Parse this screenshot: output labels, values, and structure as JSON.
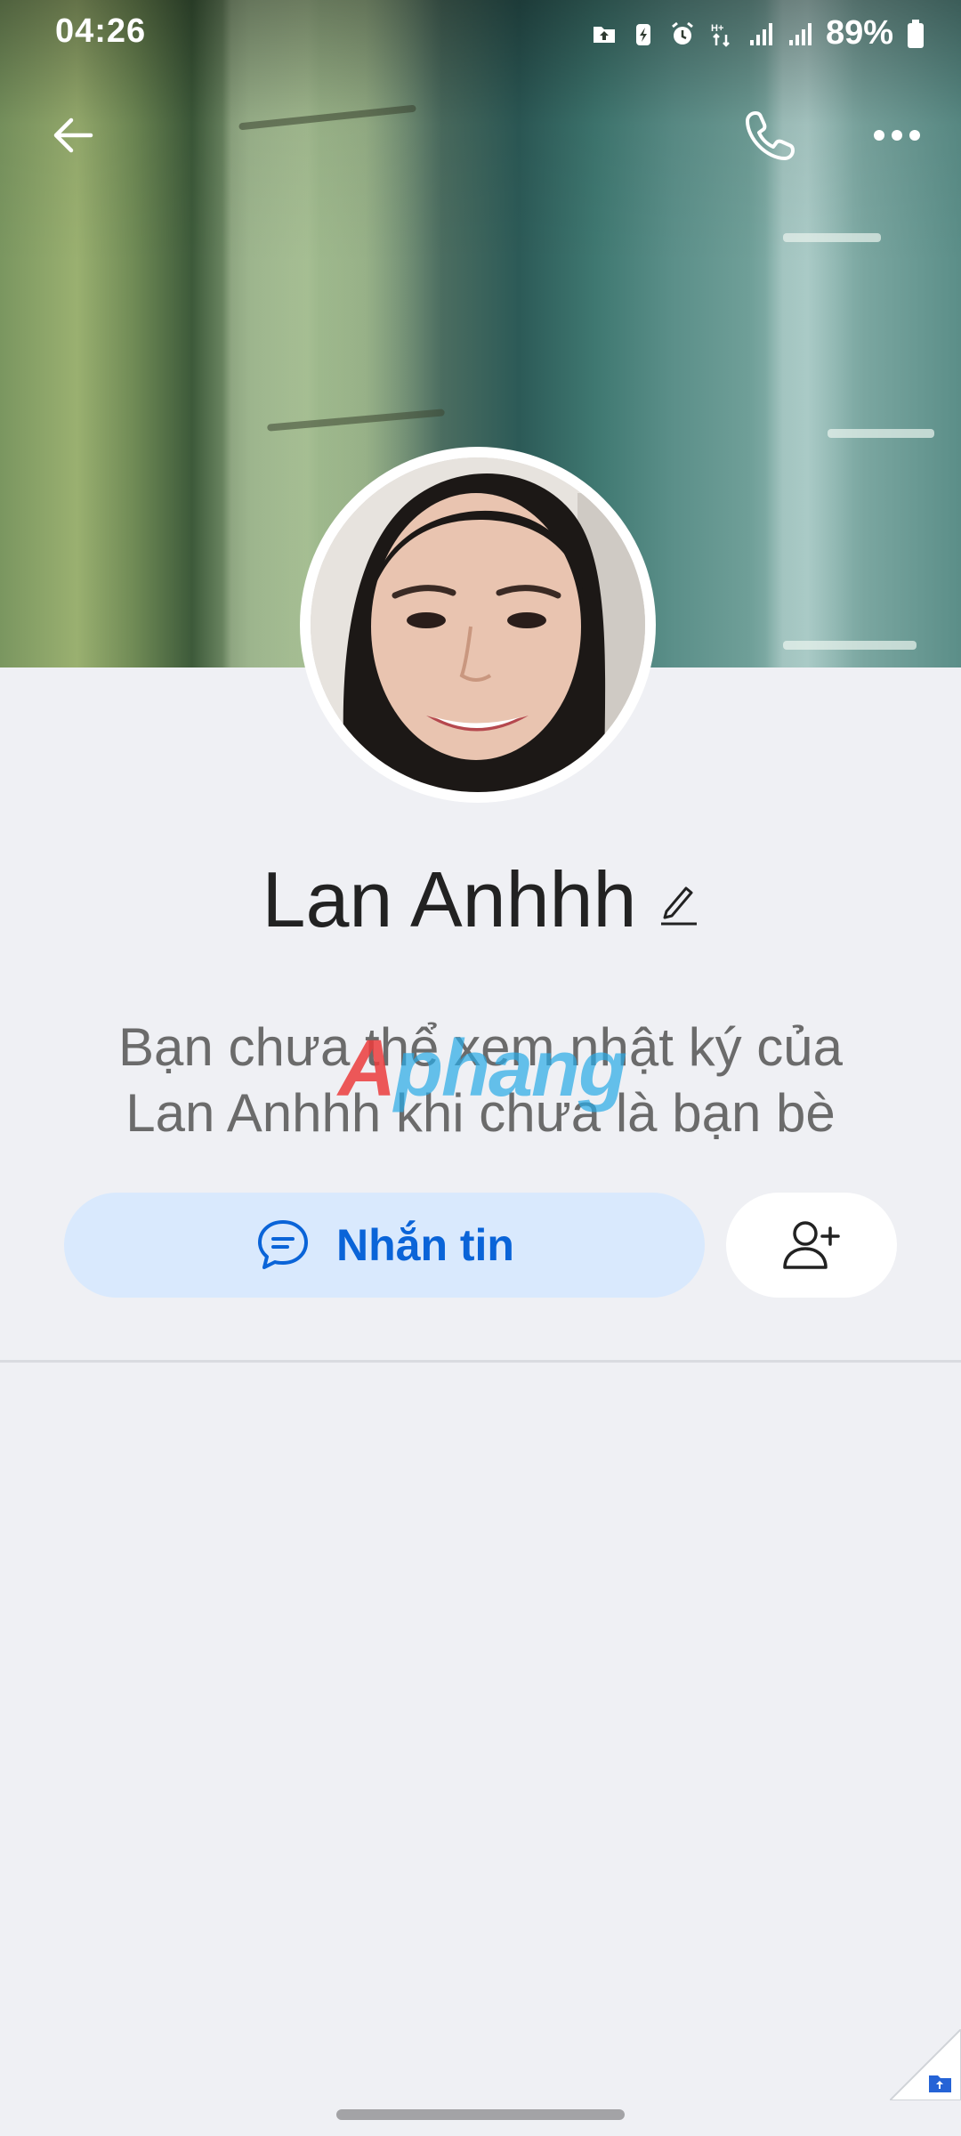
{
  "status_bar": {
    "time": "04:26",
    "battery": "89%",
    "icons": [
      "folder-upload-icon",
      "battery-saver-icon",
      "alarm-icon",
      "data-transfer-icon",
      "signal-icon",
      "signal-icon",
      "battery-icon"
    ]
  },
  "top_bar": {
    "back_icon": "back-arrow-icon",
    "call_icon": "phone-icon",
    "more_icon": "more-icon"
  },
  "profile": {
    "name": "Lan Anhhh",
    "note": "Bạn chưa thể xem nhật ký của Lan Anhhh khi chưa là bạn bè"
  },
  "actions": {
    "message_label": "Nhắn tin",
    "add_friend_icon": "add-friend-icon"
  },
  "watermark": {
    "text_red": "A",
    "text_blue": "phang"
  },
  "colors": {
    "accent": "#0a64d8",
    "message_button_bg": "#d9e9fd",
    "page_bg": "#eff0f4"
  }
}
